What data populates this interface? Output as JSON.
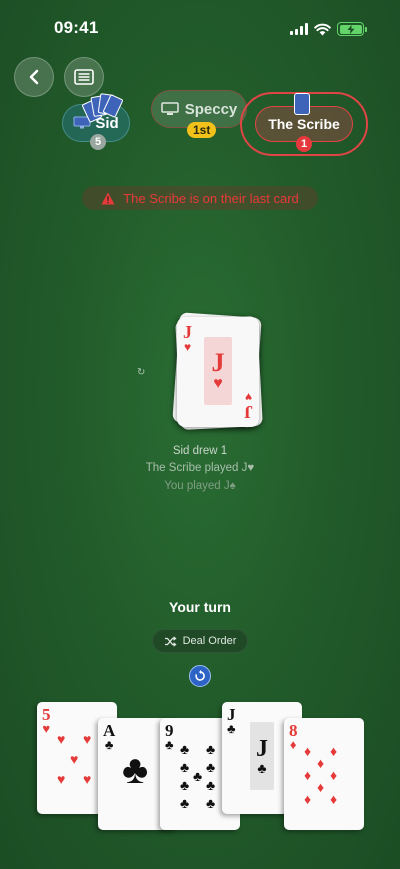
{
  "status_bar": {
    "time": "09:41"
  },
  "players": {
    "sid": {
      "name": "Sid",
      "card_count": "5"
    },
    "speccy": {
      "name": "Speccy",
      "rank": "1st"
    },
    "scribe": {
      "name": "The Scribe",
      "card_count": "1"
    }
  },
  "warning": {
    "text": "The Scribe is on their last card"
  },
  "pile": {
    "top_rank": "J",
    "top_suit": "♥"
  },
  "log": [
    "Sid drew 1",
    "The Scribe played J♥",
    "You played J♠"
  ],
  "turn": {
    "label": "Your turn"
  },
  "deal_order": {
    "label": "Deal Order"
  },
  "hand": [
    {
      "rank": "5",
      "suit": "♥",
      "color": "#e53a3a"
    },
    {
      "rank": "A",
      "suit": "♣",
      "color": "#111111"
    },
    {
      "rank": "9",
      "suit": "♣",
      "color": "#111111"
    },
    {
      "rank": "J",
      "suit": "♣",
      "color": "#111111"
    },
    {
      "rank": "8",
      "suit": "♦",
      "color": "#e53a3a"
    }
  ],
  "colors": {
    "table_green": "#225c2b",
    "warning_red": "#e83a3a",
    "rank_gold": "#f2c21a",
    "battery_green": "#63d36a"
  }
}
